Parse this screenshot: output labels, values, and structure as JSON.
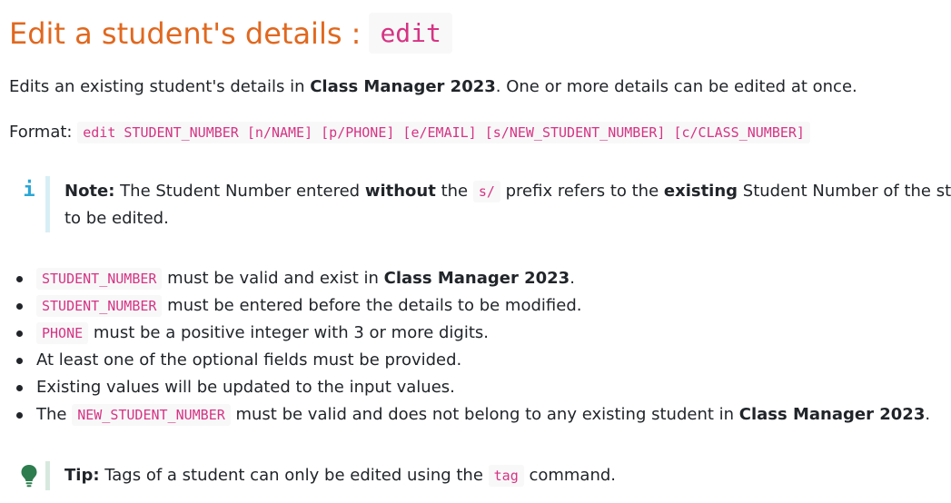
{
  "heading": {
    "title": "Edit a student's details :",
    "command": "edit"
  },
  "description": {
    "before": "Edits an existing student's details in ",
    "app_name": "Class Manager 2023",
    "after": ". One or more details can be edited at once."
  },
  "format": {
    "label": "Format:",
    "syntax": "edit STUDENT_NUMBER [n/NAME] [p/PHONE] [e/EMAIL] [s/NEW_STUDENT_NUMBER] [c/CLASS_NUMBER]"
  },
  "note": {
    "icon": "info-icon",
    "icon_glyph": "i",
    "label": "Note:",
    "part1": " The Student Number entered ",
    "without": "without",
    "part2": " the ",
    "prefix": "s/",
    "part3": " prefix refers to the ",
    "existing": "existing",
    "part4": " Student Number of the stude",
    "line2": "to be edited."
  },
  "bullets": {
    "b1": {
      "code": "STUDENT_NUMBER",
      "text": " must be valid and exist in ",
      "bold": "Class Manager 2023",
      "end": "."
    },
    "b2": {
      "code": "STUDENT_NUMBER",
      "text": " must be entered before the details to be modified."
    },
    "b3": {
      "code": "PHONE",
      "text": " must be a positive integer with 3 or more digits."
    },
    "b4": {
      "text": "At least one of the optional fields must be provided."
    },
    "b5": {
      "text": "Existing values will be updated to the input values."
    },
    "b6": {
      "start": "The ",
      "code": "NEW_STUDENT_NUMBER",
      "text": " must be valid and does not belong to any existing student in ",
      "bold": "Class Manager 2023",
      "end": "."
    }
  },
  "tip": {
    "icon": "lightbulb-icon",
    "label": "Tip:",
    "text": " Tags of a student can only be edited using the ",
    "code": "tag",
    "end": " command."
  },
  "colors": {
    "heading": "#e0681f",
    "code": "#d63384",
    "note_accent": "#2aa6d6",
    "tip_accent": "#2e7d4f"
  }
}
